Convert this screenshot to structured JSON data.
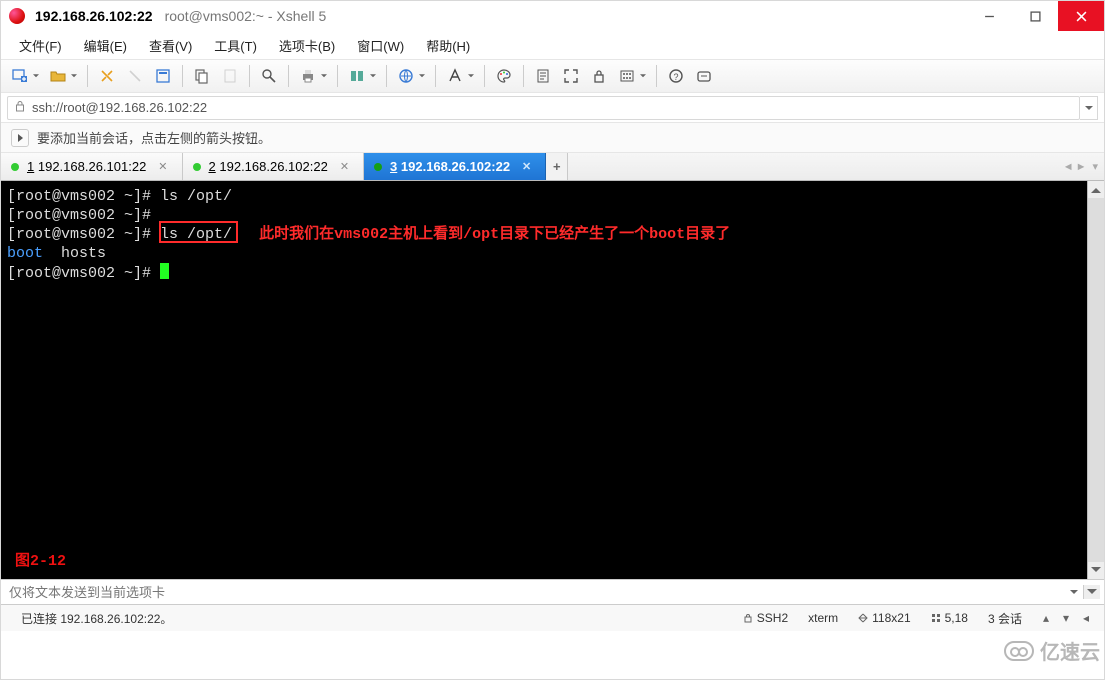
{
  "title": {
    "host": "192.168.26.102:22",
    "rest": "root@vms002:~ - Xshell 5"
  },
  "menu": {
    "items": [
      "文件(F)",
      "编辑(E)",
      "查看(V)",
      "工具(T)",
      "选项卡(B)",
      "窗口(W)",
      "帮助(H)"
    ]
  },
  "address": {
    "url": "ssh://root@192.168.26.102:22"
  },
  "info": {
    "text": "要添加当前会话，点击左侧的箭头按钮。"
  },
  "tabs": {
    "items": [
      {
        "num": "1",
        "label": "192.168.26.101:22",
        "active": false
      },
      {
        "num": "2",
        "label": "192.168.26.102:22",
        "active": false
      },
      {
        "num": "3",
        "label": "192.168.26.102:22",
        "active": true
      }
    ],
    "add": "+"
  },
  "terminal": {
    "line1_prompt": "[root@vms002 ~]#",
    "line1_cmd": " ls /opt/",
    "line2": "[root@vms002 ~]#",
    "line3_prompt": "[root@vms002 ~]#",
    "line3_cmd": " ls /opt/",
    "annotation": "此时我们在vms002主机上看到/opt目录下已经产生了一个boot目录了",
    "out_boot": "boot",
    "out_hosts": "  hosts",
    "line5": "[root@vms002 ~]# ",
    "fig": "图2-12"
  },
  "cmd": {
    "placeholder": "仅将文本发送到当前选项卡"
  },
  "status": {
    "conn": "已连接 192.168.26.102:22。",
    "proto": "SSH2",
    "term": "xterm",
    "size": "118x21",
    "pos": "5,18",
    "sessions": "3 会话"
  },
  "watermark": "亿速云"
}
